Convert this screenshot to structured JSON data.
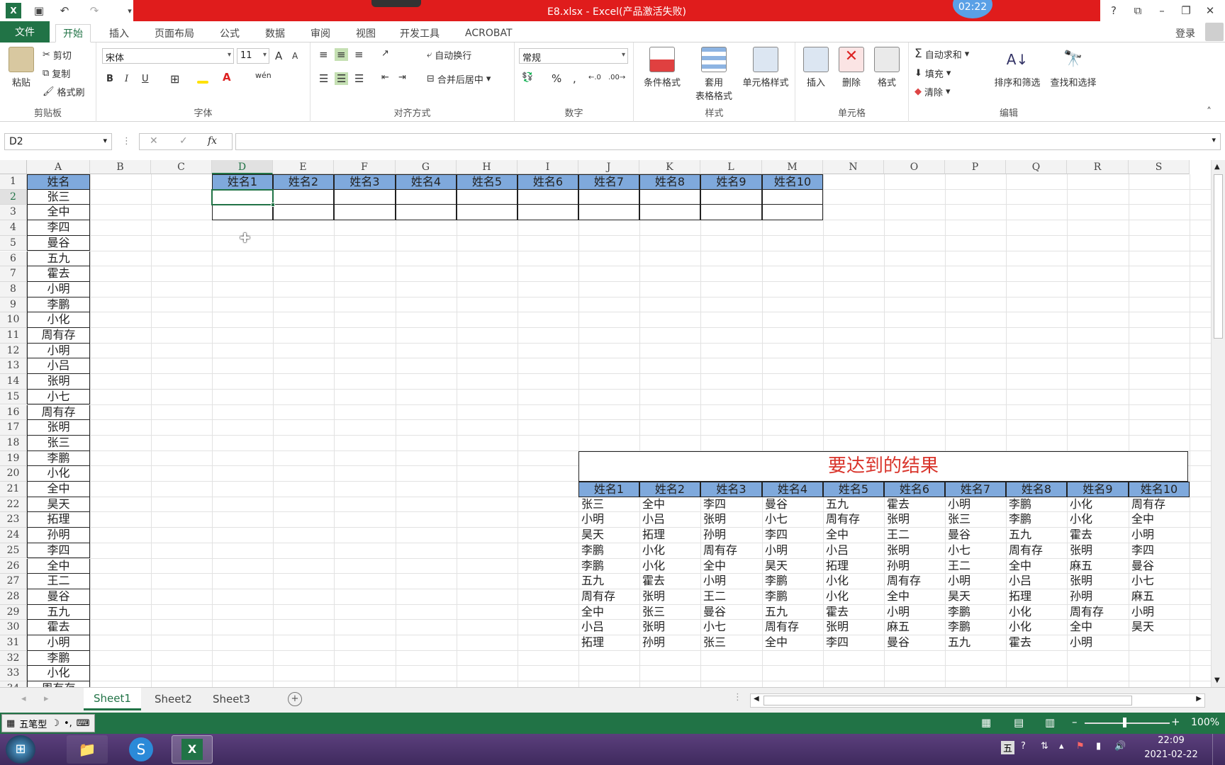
{
  "window": {
    "title": "E8.xlsx -  Excel(产品激活失败)",
    "clock_badge": "02:22"
  },
  "quick_access": {
    "excel_icon": "excel-logo-icon",
    "save_icon": "save-icon",
    "undo_icon": "undo-icon",
    "redo_icon": "redo-icon"
  },
  "window_controls": {
    "help": "?",
    "restore_ribbon": "ribbon-display-icon",
    "minimize": "minimize-icon",
    "maximize": "maximize-icon",
    "close": "close-icon"
  },
  "tabs": {
    "file": "文件",
    "items": [
      "开始",
      "插入",
      "页面布局",
      "公式",
      "数据",
      "审阅",
      "视图",
      "开发工具",
      "ACROBAT"
    ],
    "active": "开始",
    "login": "登录"
  },
  "ribbon": {
    "clipboard": {
      "paste": "粘贴",
      "cut": "剪切",
      "copy": "复制",
      "format_painter": "格式刷",
      "label": "剪贴板"
    },
    "font": {
      "name": "宋体",
      "size": "11",
      "grow": "A",
      "shrink": "A",
      "bold": "B",
      "italic": "I",
      "underline": "U",
      "phonetic": "wén",
      "label": "字体"
    },
    "alignment": {
      "wrap": "自动换行",
      "merge": "合并后居中",
      "label": "对齐方式"
    },
    "number": {
      "format": "常规",
      "percent": "%",
      "comma": ",",
      "label": "数字"
    },
    "styles": {
      "conditional": "条件格式",
      "table_line1": "套用",
      "table_line2": "表格格式",
      "cell_styles": "单元格样式",
      "label": "样式"
    },
    "cells": {
      "insert": "插入",
      "delete": "删除",
      "format": "格式",
      "label": "单元格"
    },
    "editing": {
      "autosum": "自动求和",
      "fill": "填充",
      "clear": "清除",
      "sort": "排序和筛选",
      "find": "查找和选择",
      "label": "编辑"
    }
  },
  "formula_bar": {
    "name_box": "D2",
    "cancel": "✕",
    "enter": "✓",
    "fx": "fx",
    "value": ""
  },
  "columns": [
    "A",
    "B",
    "C",
    "D",
    "E",
    "F",
    "G",
    "H",
    "I",
    "J",
    "K",
    "L",
    "M",
    "N",
    "O",
    "P",
    "Q",
    "R",
    "S"
  ],
  "rows": [
    "1",
    "2",
    "3",
    "4",
    "5",
    "6",
    "7",
    "8",
    "9",
    "10",
    "11",
    "12",
    "13",
    "14",
    "15",
    "16",
    "17",
    "18",
    "19",
    "20",
    "21",
    "22",
    "23",
    "24",
    "25",
    "26",
    "27",
    "28",
    "29",
    "30",
    "31",
    "32",
    "33",
    "34"
  ],
  "selected_cell": "D2",
  "column_a": {
    "header": "姓名",
    "values": [
      "张三",
      "全中",
      "李四",
      "曼谷",
      "五九",
      "霍去",
      "小明",
      "李鹏",
      "小化",
      "周有存",
      "小明",
      "小吕",
      "张明",
      "小七",
      "周有存",
      "张明",
      "张三",
      "李鹏",
      "小化",
      "全中",
      "昊天",
      "拓理",
      "孙明",
      "李四",
      "全中",
      "王二",
      "曼谷",
      "五九",
      "霍去",
      "小明",
      "李鹏",
      "小化",
      "周有存"
    ]
  },
  "header_row": [
    "姓名1",
    "姓名2",
    "姓名3",
    "姓名4",
    "姓名5",
    "姓名6",
    "姓名7",
    "姓名8",
    "姓名9",
    "姓名10"
  ],
  "result": {
    "title": "要达到的结果",
    "headers": [
      "姓名1",
      "姓名2",
      "姓名3",
      "姓名4",
      "姓名5",
      "姓名6",
      "姓名7",
      "姓名8",
      "姓名9",
      "姓名10"
    ],
    "rows": [
      [
        "张三",
        "全中",
        "李四",
        "曼谷",
        "五九",
        "霍去",
        "小明",
        "李鹏",
        "小化",
        "周有存"
      ],
      [
        "小明",
        "小吕",
        "张明",
        "小七",
        "周有存",
        "张明",
        "张三",
        "李鹏",
        "小化",
        "全中"
      ],
      [
        "昊天",
        "拓理",
        "孙明",
        "李四",
        "全中",
        "王二",
        "曼谷",
        "五九",
        "霍去",
        "小明"
      ],
      [
        "李鹏",
        "小化",
        "周有存",
        "小明",
        "小吕",
        "张明",
        "小七",
        "周有存",
        "张明",
        "李四"
      ],
      [
        "李鹏",
        "小化",
        "全中",
        "昊天",
        "拓理",
        "孙明",
        "王二",
        "全中",
        "麻五",
        "曼谷"
      ],
      [
        "五九",
        "霍去",
        "小明",
        "李鹏",
        "小化",
        "周有存",
        "小明",
        "小吕",
        "张明",
        "小七"
      ],
      [
        "周有存",
        "张明",
        "王二",
        "李鹏",
        "小化",
        "全中",
        "昊天",
        "拓理",
        "孙明",
        "麻五"
      ],
      [
        "全中",
        "张三",
        "曼谷",
        "五九",
        "霍去",
        "小明",
        "李鹏",
        "小化",
        "周有存",
        "小明"
      ],
      [
        "小吕",
        "张明",
        "小七",
        "周有存",
        "张明",
        "麻五",
        "李鹏",
        "小化",
        "全中",
        "昊天"
      ],
      [
        "拓理",
        "孙明",
        "张三",
        "全中",
        "李四",
        "曼谷",
        "五九",
        "霍去",
        "小明",
        ""
      ]
    ]
  },
  "sheets": [
    "Sheet1",
    "Sheet2",
    "Sheet3"
  ],
  "active_sheet": "Sheet1",
  "status": {
    "ime": "五笔型",
    "zoom": "100%"
  },
  "taskbar": {
    "time": "22:09",
    "date": "2021-02-22",
    "ime_tray": "五"
  },
  "colors": {
    "excel_green": "#217346",
    "header_fill": "#7fa9dc",
    "title_red": "#e01c1c",
    "result_title": "#d9342b"
  }
}
